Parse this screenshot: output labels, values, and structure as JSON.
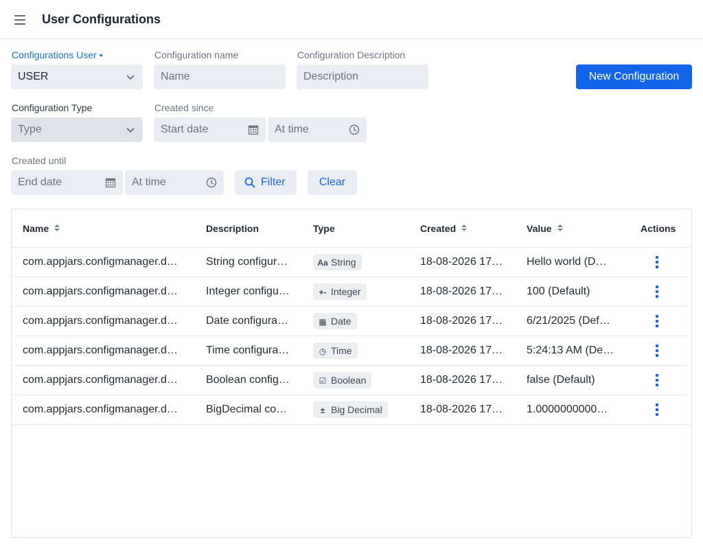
{
  "header": {
    "title": "User Configurations",
    "menu_icon": "menu-icon"
  },
  "filters": {
    "user": {
      "label": "Configurations User",
      "required_mark": "•",
      "value": "USER"
    },
    "name": {
      "label": "Configuration name",
      "placeholder": "Name"
    },
    "description": {
      "label": "Configuration Description",
      "placeholder": "Description"
    },
    "type": {
      "label": "Configuration Type",
      "placeholder": "Type"
    },
    "created_since": {
      "label": "Created since",
      "date_placeholder": "Start date",
      "time_placeholder": "At time"
    },
    "created_until": {
      "label": "Created until",
      "date_placeholder": "End date",
      "time_placeholder": "At time"
    },
    "filter_label": "Filter",
    "clear_label": "Clear"
  },
  "new_button": "New Configuration",
  "colors": {
    "accent": "#1465e8",
    "field_bg": "#e9ecf0",
    "label_active": "#1a6fd0"
  },
  "table": {
    "columns": [
      "Name",
      "Description",
      "Type",
      "Created",
      "Value",
      "Actions"
    ],
    "rows": [
      {
        "name": "com.appjars.configmanager.d…",
        "description": "String configur…",
        "type": "String",
        "type_icon": "Aa",
        "created": "18-08-2026 17…",
        "value": "Hello world (D…"
      },
      {
        "name": "com.appjars.configmanager.d…",
        "description": "Integer configu…",
        "type": "Integer",
        "type_icon": "+-",
        "created": "18-08-2026 17…",
        "value": "100 (Default)"
      },
      {
        "name": "com.appjars.configmanager.d…",
        "description": "Date configura…",
        "type": "Date",
        "type_icon": "▦",
        "created": "18-08-2026 17…",
        "value": "6/21/2025 (Def…"
      },
      {
        "name": "com.appjars.configmanager.d…",
        "description": "Time configura…",
        "type": "Time",
        "type_icon": "◷",
        "created": "18-08-2026 17…",
        "value": "5:24:13 AM (De…"
      },
      {
        "name": "com.appjars.configmanager.d…",
        "description": "Boolean config…",
        "type": "Boolean",
        "type_icon": "☑",
        "created": "18-08-2026 17…",
        "value": "false (Default)"
      },
      {
        "name": "com.appjars.configmanager.d…",
        "description": "BigDecimal co…",
        "type": "Big Decimal",
        "type_icon": "±",
        "created": "18-08-2026 17…",
        "value": "1.0000000000…"
      }
    ]
  }
}
